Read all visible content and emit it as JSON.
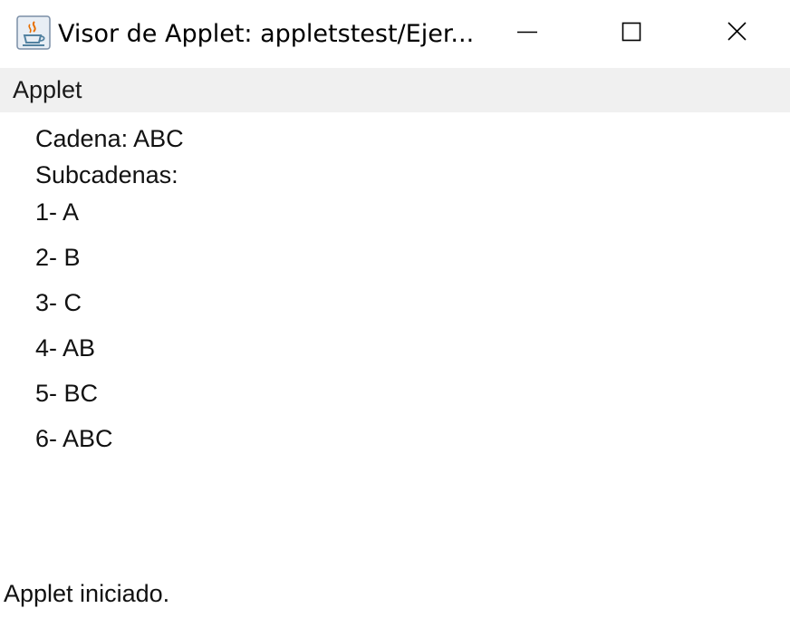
{
  "window": {
    "title": "Visor de Applet: appletstest/Ejer...",
    "app_icon": "java-coffee-icon",
    "controls": {
      "minimize_icon": "minimize-icon",
      "maximize_icon": "maximize-icon",
      "close_icon": "close-icon"
    }
  },
  "menubar": {
    "items": [
      {
        "label": "Applet"
      }
    ]
  },
  "applet": {
    "cadena": "Cadena: ABC",
    "subcadenas_heading": "Subcadenas:",
    "subcadenas": [
      "1- A",
      "2- B",
      "3- C",
      "4- AB",
      "5- BC",
      "6- ABC"
    ]
  },
  "status": {
    "text": "Applet iniciado."
  },
  "colors": {
    "menubar_bg": "#f0f0f0",
    "window_bg": "#ffffff",
    "icon_orange": "#e76f00",
    "icon_blue": "#5382a1"
  }
}
